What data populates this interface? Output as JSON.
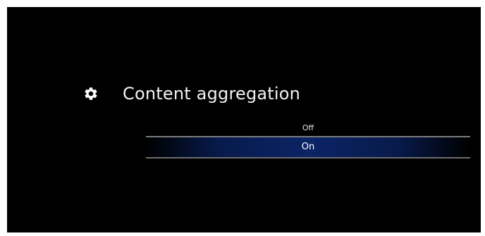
{
  "setting": {
    "title": "Content aggregation",
    "icon": "gear-icon"
  },
  "options": [
    {
      "label": "Off",
      "selected": false
    },
    {
      "label": "On",
      "selected": true
    }
  ],
  "colors": {
    "background": "#000000",
    "highlight": "#0b2466",
    "divider": "#7c7c7c",
    "text": "#f2f2f2"
  }
}
